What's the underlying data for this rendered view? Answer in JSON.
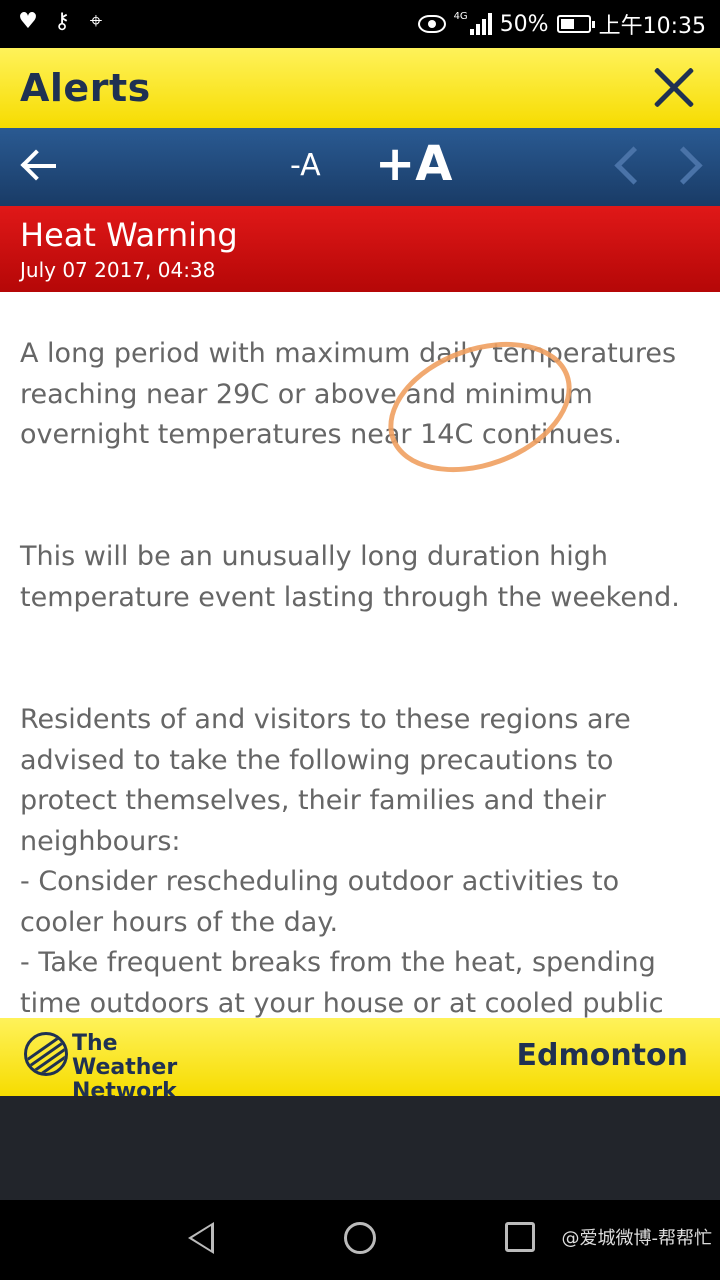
{
  "status_bar": {
    "battery": "50%",
    "time": "上午10:35",
    "network": "4G"
  },
  "header": {
    "title": "Alerts"
  },
  "toolbar": {
    "font_smaller": "-A",
    "font_larger": "+A"
  },
  "alert": {
    "name": "Heat Warning",
    "date": "July 07 2017, 04:38",
    "paragraphs": [
      "A long period with maximum daily temperatures reaching near 29C or above and minimum overnight temperatures near 14C continues.",
      "This will be an unusually long duration high temperature event lasting through the weekend.",
      "Residents of and visitors to these regions are advised to take the following precautions to protect themselves, their families and their neighbours:\n- Consider rescheduling outdoor activities to cooler hours of the day.\n- Take frequent breaks from the heat, spending time outdoors at your house or at cooled public"
    ]
  },
  "footer": {
    "brand": "The Weather Network",
    "city": "Edmonton"
  },
  "watermark": "@爱城微博-帮帮忙"
}
